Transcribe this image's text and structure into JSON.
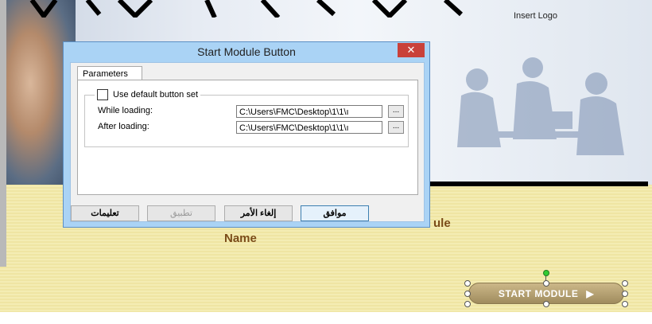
{
  "slide": {
    "insert_logo": "Insert Logo",
    "module_text": "ule",
    "name_text": "Name",
    "start_button": {
      "label": "START MODULE",
      "icon": "play-icon"
    }
  },
  "dialog": {
    "title": "Start Module Button",
    "close_label": "✕",
    "tabs": [
      {
        "label": "Parameters",
        "selected": true
      }
    ],
    "use_default": {
      "label": "Use default button set",
      "checked": false
    },
    "fields": [
      {
        "label": "While loading:",
        "value": "C:\\Users\\FMC\\Desktop\\1\\1\\ı",
        "browse": "..."
      },
      {
        "label": "After loading:",
        "value": "C:\\Users\\FMC\\Desktop\\1\\1\\ı",
        "browse": "..."
      }
    ],
    "buttons": {
      "ok": "موافق",
      "cancel": "إلغاء الأمر",
      "apply": "تطبيق",
      "help": "تعليمات"
    }
  },
  "colors": {
    "dialog_frame": "#aad3f5",
    "close_button": "#c9413a",
    "slide_yellow": "#f4ecb3",
    "slide_text": "#7a4b18",
    "button_tan": "#b8a473"
  }
}
